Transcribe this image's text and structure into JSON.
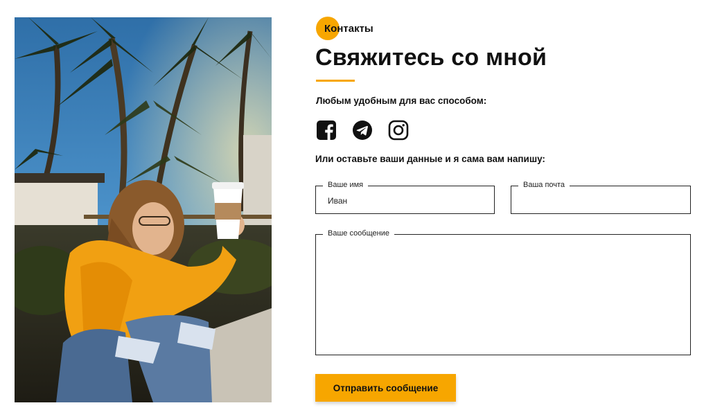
{
  "section": {
    "label": "Контакты"
  },
  "heading": {
    "title": "Свяжитесь со мной"
  },
  "contact": {
    "intro": "Любым удобным для вас способом:",
    "socials": [
      "facebook-icon",
      "telegram-icon",
      "instagram-icon"
    ],
    "form_intro": "Или оставьте ваши данные и я сама вам напишу:"
  },
  "form": {
    "name": {
      "label": "Ваше имя",
      "value": "Иван"
    },
    "email": {
      "label": "Ваша почта",
      "value": ""
    },
    "message": {
      "label": "Ваше сообщение",
      "value": ""
    },
    "submit_label": "Отправить сообщение"
  },
  "colors": {
    "accent": "#f7a600",
    "text": "#111111",
    "border": "#222222"
  }
}
